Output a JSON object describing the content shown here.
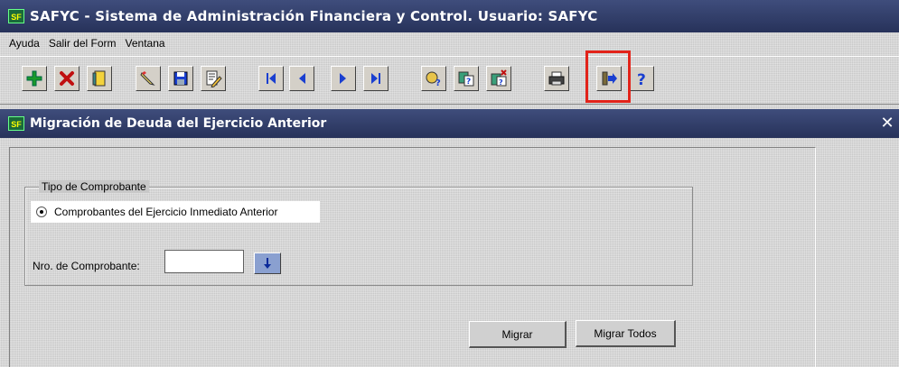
{
  "app": {
    "icon_label": "SF",
    "title": "SAFYC - Sistema de Administración Financiera y Control. Usuario: SAFYC"
  },
  "menu": [
    "Ayuda",
    "Salir del Form",
    "Ventana"
  ],
  "toolbar": {
    "buttons": [
      {
        "icon": "add-record-icon"
      },
      {
        "icon": "delete-record-icon"
      },
      {
        "icon": "clear-form-icon"
      },
      {
        "icon": "edit-icon"
      },
      {
        "icon": "save-icon"
      },
      {
        "icon": "edit-document-icon"
      },
      {
        "icon": "first-record-icon"
      },
      {
        "icon": "previous-record-icon"
      },
      {
        "icon": "next-record-icon"
      },
      {
        "icon": "last-record-icon"
      },
      {
        "icon": "enter-query-icon"
      },
      {
        "icon": "execute-query-icon"
      },
      {
        "icon": "cancel-query-icon"
      },
      {
        "icon": "print-icon"
      },
      {
        "icon": "exit-icon",
        "highlighted": true
      },
      {
        "icon": "help-icon"
      }
    ],
    "highlight_color": "#e2231a"
  },
  "form": {
    "title": "Migración de Deuda del Ejercicio Anterior",
    "close_label": "✕",
    "group_label": "Tipo de Comprobante",
    "radio_option": "Comprobantes del Ejercicio Inmediato Anterior",
    "nro_label": "Nro. de Comprobante:",
    "nro_value": "",
    "migrar_label": "Migrar",
    "migrar_todos_label": "Migrar Todos"
  },
  "colors": {
    "titlebar": "#2f3b66",
    "background": "#c8c8c8",
    "toolbar_blue": "#1a3fd0"
  }
}
